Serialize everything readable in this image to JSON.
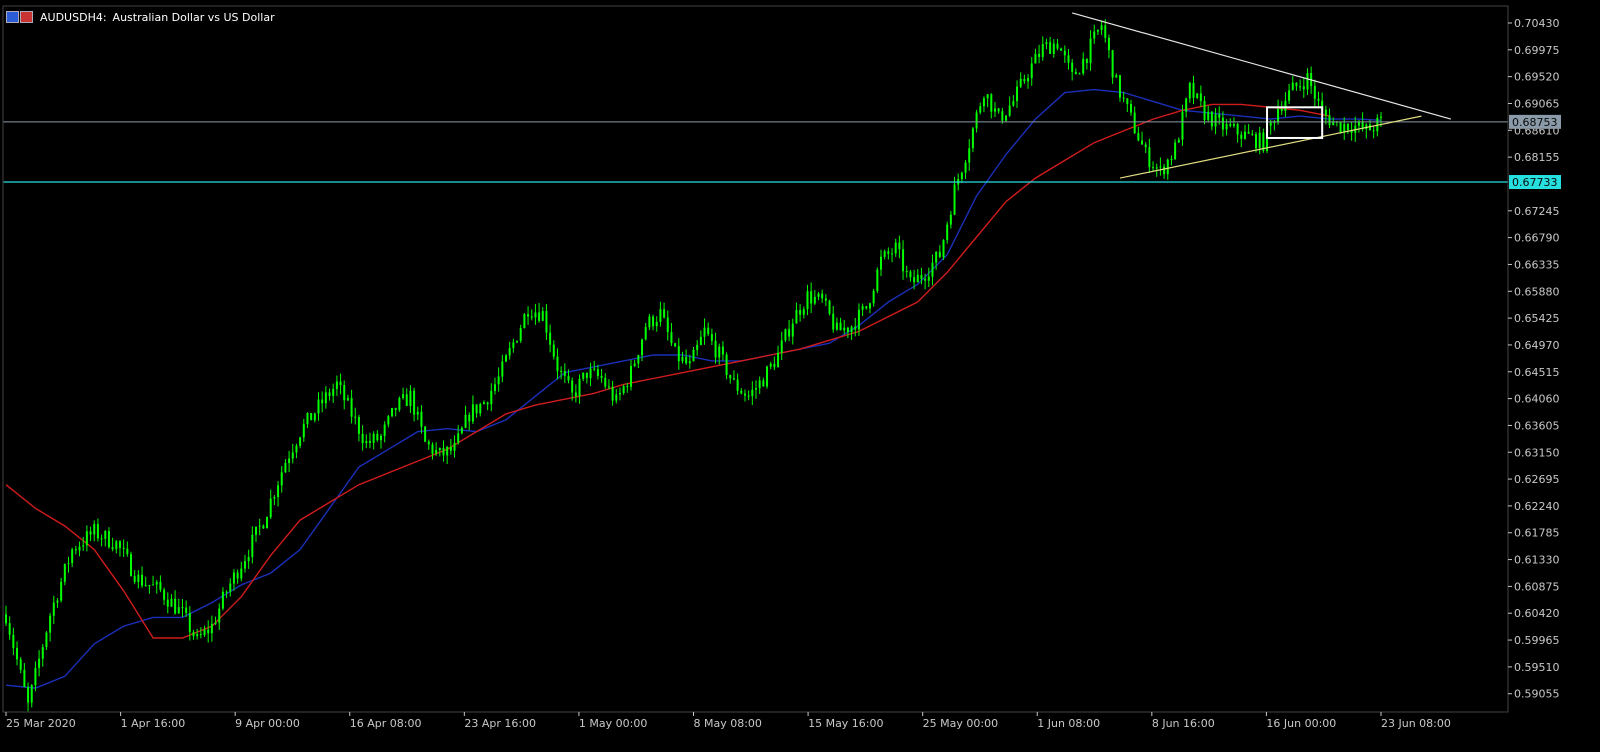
{
  "header": {
    "symbol": "AUDUSD",
    "timeframe": "H4:",
    "description": "Australian Dollar vs US Dollar"
  },
  "colors": {
    "background": "#000000",
    "bull_candle": "#00ff00",
    "ma_fast": "#1b2fb8",
    "ma_slow": "#d01c1c",
    "price_line": "#8a9aa8",
    "support_line": "#26e0e0",
    "trend_upper": "#e6e6e6",
    "trend_lower": "#e0dc80",
    "consolidation_box": "#ffffff",
    "axis": "#c8c8c8"
  },
  "chart_data": {
    "type": "candlestick",
    "ylim": [
      0.58745,
      0.70718
    ],
    "y_ticks": [
      "0.70430",
      "0.69975",
      "0.69520",
      "0.69065",
      "0.68610",
      "0.68155",
      "0.67245",
      "0.66790",
      "0.66335",
      "0.65880",
      "0.65425",
      "0.64970",
      "0.64515",
      "0.64060",
      "0.63605",
      "0.63150",
      "0.62695",
      "0.62240",
      "0.61785",
      "0.61330",
      "0.60875",
      "0.60420",
      "0.59965",
      "0.59510",
      "0.59055"
    ],
    "x_ticks": [
      "25 Mar 2020",
      "1 Apr 16:00",
      "9 Apr 00:00",
      "16 Apr 08:00",
      "23 Apr 16:00",
      "1 May 00:00",
      "8 May 08:00",
      "15 May 16:00",
      "25 May 00:00",
      "1 Jun 08:00",
      "8 Jun 16:00",
      "16 Jun 00:00",
      "23 Jun 08:00"
    ],
    "current_price": {
      "label": "0.68753",
      "value": 0.68753
    },
    "horizontal_level": {
      "label": "0.67733",
      "value": 0.67733
    },
    "close_path": [
      [
        0,
        0.604
      ],
      [
        6,
        0.5885
      ],
      [
        12,
        0.604
      ],
      [
        18,
        0.615
      ],
      [
        24,
        0.618
      ],
      [
        30,
        0.616
      ],
      [
        36,
        0.61
      ],
      [
        42,
        0.608
      ],
      [
        48,
        0.604
      ],
      [
        52,
        0.5995
      ],
      [
        56,
        0.602
      ],
      [
        60,
        0.608
      ],
      [
        66,
        0.615
      ],
      [
        70,
        0.62
      ],
      [
        76,
        0.63
      ],
      [
        80,
        0.635
      ],
      [
        86,
        0.64
      ],
      [
        90,
        0.643
      ],
      [
        94,
        0.638
      ],
      [
        98,
        0.633
      ],
      [
        102,
        0.634
      ],
      [
        106,
        0.639
      ],
      [
        110,
        0.641
      ],
      [
        114,
        0.633
      ],
      [
        118,
        0.631
      ],
      [
        122,
        0.632
      ],
      [
        126,
        0.638
      ],
      [
        130,
        0.64
      ],
      [
        134,
        0.644
      ],
      [
        138,
        0.65
      ],
      [
        142,
        0.656
      ],
      [
        146,
        0.655
      ],
      [
        150,
        0.646
      ],
      [
        154,
        0.641
      ],
      [
        158,
        0.645
      ],
      [
        162,
        0.644
      ],
      [
        166,
        0.64
      ],
      [
        170,
        0.645
      ],
      [
        174,
        0.653
      ],
      [
        178,
        0.655
      ],
      [
        182,
        0.648
      ],
      [
        186,
        0.646
      ],
      [
        190,
        0.652
      ],
      [
        194,
        0.648
      ],
      [
        198,
        0.643
      ],
      [
        202,
        0.641
      ],
      [
        206,
        0.644
      ],
      [
        210,
        0.648
      ],
      [
        214,
        0.654
      ],
      [
        218,
        0.658
      ],
      [
        222,
        0.657
      ],
      [
        226,
        0.652
      ],
      [
        230,
        0.653
      ],
      [
        234,
        0.656
      ],
      [
        238,
        0.664
      ],
      [
        242,
        0.666
      ],
      [
        246,
        0.66
      ],
      [
        250,
        0.662
      ],
      [
        254,
        0.665
      ],
      [
        258,
        0.676
      ],
      [
        262,
        0.684
      ],
      [
        266,
        0.693
      ],
      [
        270,
        0.688
      ],
      [
        274,
        0.691
      ],
      [
        278,
        0.696
      ],
      [
        282,
        0.7
      ],
      [
        286,
        0.701
      ],
      [
        290,
        0.695
      ],
      [
        294,
        0.699
      ],
      [
        298,
        0.704
      ],
      [
        302,
        0.694
      ],
      [
        306,
        0.688
      ],
      [
        310,
        0.682
      ],
      [
        314,
        0.679
      ],
      [
        318,
        0.683
      ],
      [
        322,
        0.693
      ],
      [
        326,
        0.689
      ],
      [
        330,
        0.687
      ],
      [
        334,
        0.686
      ],
      [
        338,
        0.685
      ],
      [
        342,
        0.684
      ],
      [
        346,
        0.69
      ],
      [
        350,
        0.693
      ],
      [
        354,
        0.695
      ],
      [
        358,
        0.689
      ],
      [
        362,
        0.687
      ],
      [
        366,
        0.687
      ],
      [
        370,
        0.686
      ],
      [
        374,
        0.6875
      ]
    ],
    "ma_fast": [
      [
        0,
        0.592
      ],
      [
        8,
        0.5915
      ],
      [
        16,
        0.5935
      ],
      [
        24,
        0.599
      ],
      [
        32,
        0.602
      ],
      [
        40,
        0.6035
      ],
      [
        48,
        0.6035
      ],
      [
        56,
        0.606
      ],
      [
        64,
        0.609
      ],
      [
        72,
        0.611
      ],
      [
        80,
        0.615
      ],
      [
        88,
        0.622
      ],
      [
        96,
        0.629
      ],
      [
        104,
        0.632
      ],
      [
        112,
        0.635
      ],
      [
        120,
        0.6355
      ],
      [
        128,
        0.635
      ],
      [
        136,
        0.637
      ],
      [
        144,
        0.641
      ],
      [
        152,
        0.645
      ],
      [
        160,
        0.646
      ],
      [
        168,
        0.647
      ],
      [
        176,
        0.648
      ],
      [
        184,
        0.648
      ],
      [
        192,
        0.647
      ],
      [
        200,
        0.647
      ],
      [
        208,
        0.648
      ],
      [
        216,
        0.649
      ],
      [
        224,
        0.65
      ],
      [
        232,
        0.653
      ],
      [
        240,
        0.657
      ],
      [
        248,
        0.66
      ],
      [
        256,
        0.665
      ],
      [
        264,
        0.675
      ],
      [
        272,
        0.682
      ],
      [
        280,
        0.688
      ],
      [
        288,
        0.6925
      ],
      [
        296,
        0.693
      ],
      [
        304,
        0.6925
      ],
      [
        312,
        0.691
      ],
      [
        320,
        0.6895
      ],
      [
        328,
        0.689
      ],
      [
        336,
        0.6885
      ],
      [
        344,
        0.688
      ],
      [
        352,
        0.6885
      ],
      [
        360,
        0.688
      ],
      [
        368,
        0.688
      ],
      [
        374,
        0.6878
      ]
    ],
    "ma_slow": [
      [
        0,
        0.626
      ],
      [
        8,
        0.622
      ],
      [
        16,
        0.619
      ],
      [
        24,
        0.615
      ],
      [
        32,
        0.608
      ],
      [
        40,
        0.6
      ],
      [
        48,
        0.6
      ],
      [
        56,
        0.602
      ],
      [
        64,
        0.607
      ],
      [
        72,
        0.614
      ],
      [
        80,
        0.62
      ],
      [
        88,
        0.623
      ],
      [
        96,
        0.626
      ],
      [
        104,
        0.628
      ],
      [
        112,
        0.63
      ],
      [
        120,
        0.632
      ],
      [
        128,
        0.635
      ],
      [
        136,
        0.638
      ],
      [
        144,
        0.6395
      ],
      [
        152,
        0.6405
      ],
      [
        160,
        0.6415
      ],
      [
        168,
        0.643
      ],
      [
        176,
        0.644
      ],
      [
        184,
        0.645
      ],
      [
        192,
        0.646
      ],
      [
        200,
        0.647
      ],
      [
        208,
        0.648
      ],
      [
        216,
        0.649
      ],
      [
        224,
        0.6505
      ],
      [
        232,
        0.652
      ],
      [
        240,
        0.6545
      ],
      [
        248,
        0.657
      ],
      [
        256,
        0.662
      ],
      [
        264,
        0.668
      ],
      [
        272,
        0.674
      ],
      [
        280,
        0.678
      ],
      [
        288,
        0.681
      ],
      [
        296,
        0.684
      ],
      [
        304,
        0.686
      ],
      [
        312,
        0.688
      ],
      [
        320,
        0.6895
      ],
      [
        328,
        0.6905
      ],
      [
        336,
        0.6905
      ],
      [
        344,
        0.69
      ],
      [
        352,
        0.6895
      ],
      [
        360,
        0.6885
      ]
    ],
    "annotations": {
      "trendline_upper": [
        [
          290,
          0.706
        ],
        [
          393,
          0.688
        ]
      ],
      "trendline_lower": [
        [
          303,
          0.678
        ],
        [
          385,
          0.6885
        ]
      ],
      "consolidation_box": {
        "x": [
          343,
          358
        ],
        "y": [
          0.6848,
          0.69
        ]
      }
    },
    "bar_count": 375
  }
}
